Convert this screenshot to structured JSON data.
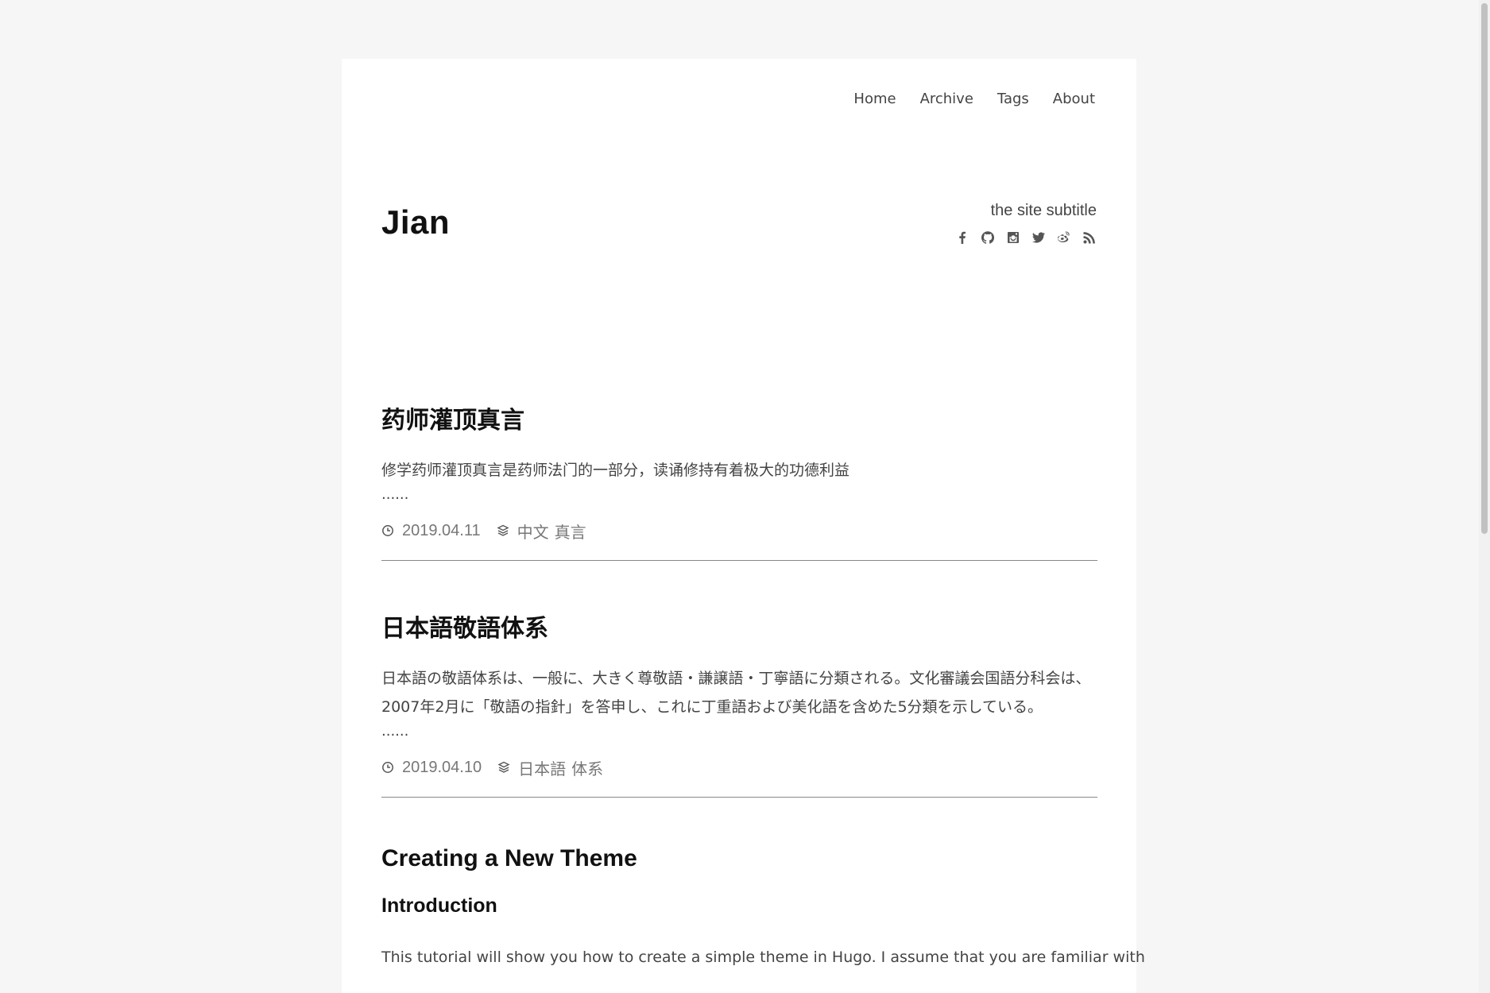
{
  "nav": {
    "items": [
      "Home",
      "Archive",
      "Tags",
      "About"
    ]
  },
  "site": {
    "title": "Jian",
    "subtitle": "the site subtitle",
    "socials": [
      "facebook-icon",
      "github-icon",
      "instagram-icon",
      "twitter-icon",
      "weibo-icon",
      "rss-icon"
    ]
  },
  "posts": [
    {
      "title": "药师灌顶真言",
      "summary": "修学药师灌顶真言是药师法门的一部分，读诵修持有着极大的功德利益",
      "ellipsis": "......",
      "date": "2019.04.11",
      "tags": [
        "中文",
        "真言"
      ]
    },
    {
      "title": "日本語敬語体系",
      "summary": "日本語の敬語体系は、一般に、大きく尊敬語・謙譲語・丁寧語に分類される。文化審議会国語分科会は、2007年2月に「敬語の指針」を答申し、これに丁重語および美化語を含めた5分類を示している。",
      "ellipsis": "......",
      "date": "2019.04.10",
      "tags": [
        "日本語",
        "体系"
      ]
    },
    {
      "title": "Creating a New Theme",
      "subheading": "Introduction",
      "text": "This tutorial will show you how to create a simple theme in Hugo. I assume that you are familiar with"
    }
  ],
  "colors": {
    "background": "#f6f6f6",
    "card": "#ffffff",
    "text": "#333333",
    "meta": "#777777"
  }
}
